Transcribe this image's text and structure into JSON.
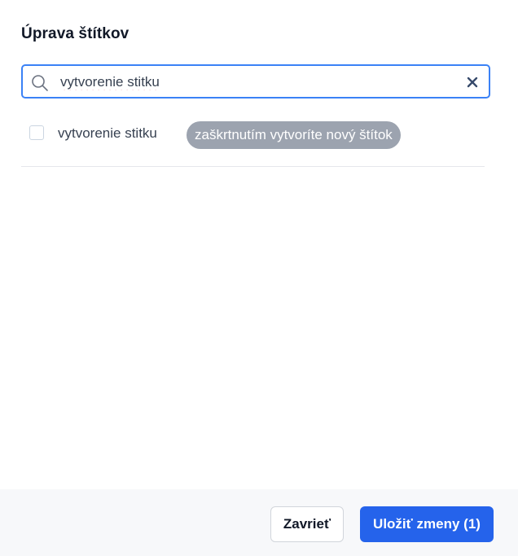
{
  "dialog": {
    "title": "Úprava štítkov"
  },
  "search": {
    "value": "vytvorenie stitku",
    "search_icon": "search-icon",
    "clear_icon": "close-icon"
  },
  "option": {
    "checked": false,
    "label": "vytvorenie stitku",
    "hint": "zaškrtnutím vytvoríte nový štítok"
  },
  "footer": {
    "close_label": "Zavrieť",
    "save_label": "Uložiť zmeny (1)"
  },
  "colors": {
    "primary": "#2563eb",
    "focus_border": "#3b82f6",
    "badge_bg": "#9ca3af",
    "footer_bg": "#f7f8fa"
  }
}
